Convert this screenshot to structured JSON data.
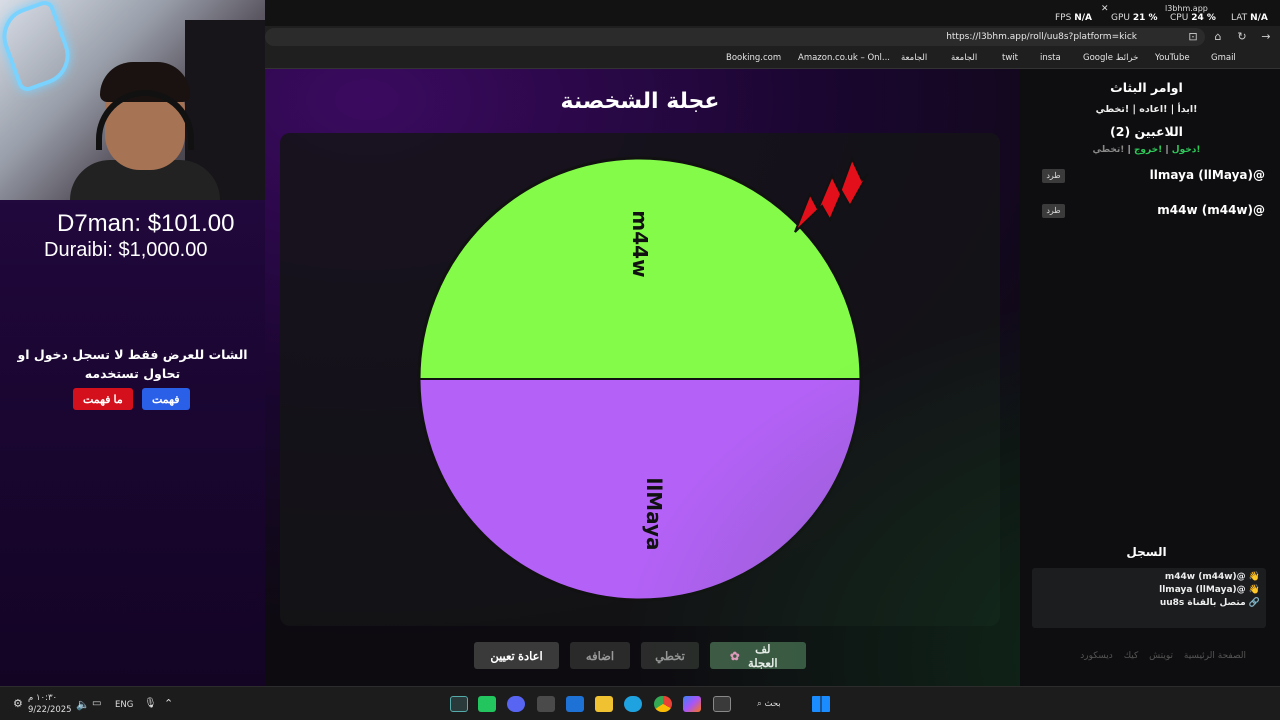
{
  "overlay": {
    "money_line_1": "D7man: $101.00",
    "money_line_2": "Duraibi: $1,000.00",
    "chat_warning": "الشات للعرض فقط لا تسجل دخول او تحاول تستخدمه",
    "btn_understood": "فهمت",
    "btn_not_understood": "ما فهمت"
  },
  "stats": {
    "fps_label": "FPS",
    "fps_value": "N/A",
    "gpu_label": "GPU",
    "gpu_value": "21 %",
    "cpu_label": "CPU",
    "cpu_value": "24 %",
    "lat_label": "LAT",
    "lat_value": "N/A",
    "tab_title": "l3bhm.app"
  },
  "browser": {
    "url": "https://l3bhm.app/roll/uu8s?platform=kick",
    "bookmarks": [
      "Gmail",
      "YouTube",
      "Google خرائط",
      "insta",
      "twit",
      "الجامعة",
      "الجامعة",
      "Amazon.co.uk – Onl...",
      "Booking.com"
    ]
  },
  "wheel": {
    "title": "عجلة الشخصنة",
    "segments": [
      {
        "label": "m44w",
        "color": "#84fb48"
      },
      {
        "label": "llMaya",
        "color": "#b461f7"
      }
    ],
    "pointer_color": "#e3101b"
  },
  "controls": {
    "spin": "لف العجلة",
    "spin_icon": "flower-icon",
    "skip": "تخطي",
    "add": "اضافه",
    "reset": "اعادة تعيين"
  },
  "sidebar": {
    "commands_title": "اوامر البثاث",
    "commands": "!ابدأ | !اعاده | !تخطي",
    "players_title": "اللاعبين (2)",
    "player_cmd_join": "!دخول",
    "player_cmd_exit": "!خروج",
    "player_cmd_skip": "!تخطي",
    "sep": "|",
    "players": [
      {
        "name": "llmaya (llMaya)@",
        "kick": "طرد"
      },
      {
        "name": "m44w (m44w)@",
        "kick": "طرد"
      }
    ],
    "log_title": "السجل",
    "log": [
      "👋 @m44w (m44w)",
      "👋 @llmaya (llMaya)",
      "🔗 متصل بالقناة uu8s"
    ],
    "footer_links": [
      "الصفحة الرئيسية",
      "تويتش",
      "كيك",
      "ديسكورد"
    ]
  },
  "taskbar": {
    "time": "١٠:٣٠ م",
    "date": "9/22/2025",
    "lang": "ENG",
    "search": "بحث"
  }
}
